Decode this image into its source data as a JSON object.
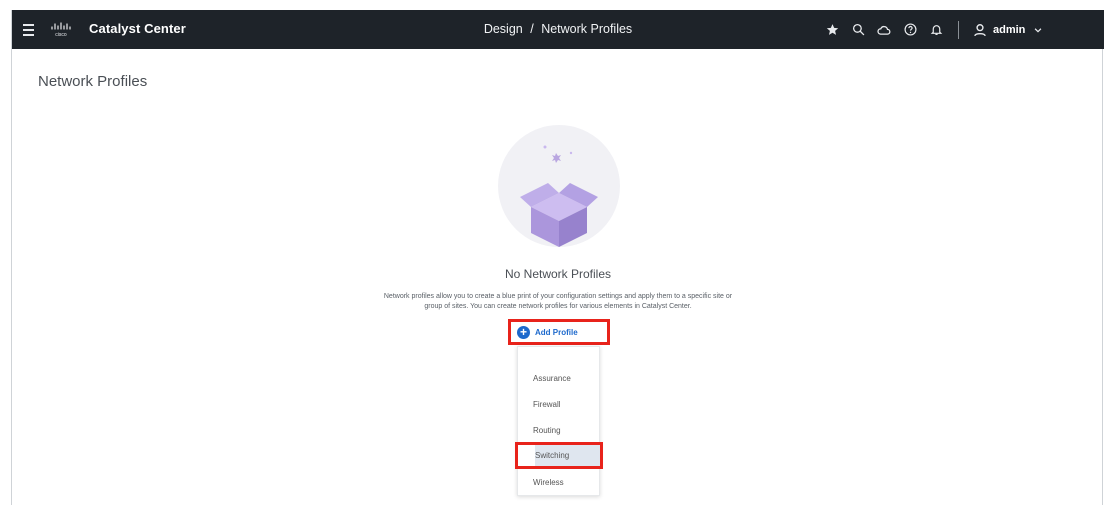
{
  "header": {
    "app_title": "Catalyst Center",
    "breadcrumb": [
      "Design",
      "/",
      "Network Profiles"
    ],
    "user_name": "admin",
    "icons": [
      "star-icon",
      "search-icon",
      "cloud-icon",
      "help-icon",
      "bell-icon",
      "user-icon",
      "chevron-down-icon"
    ]
  },
  "page": {
    "title": "Network Profiles"
  },
  "empty_state": {
    "title": "No Network Profiles",
    "description_line1": "Network profiles allow you to create a blue print of your configuration settings and apply them to a specific site or",
    "description_line2": "group of sites. You can create network profiles for various elements in Catalyst Center."
  },
  "add_button": {
    "label": "Add Profile"
  },
  "menu": {
    "items": [
      "Assurance",
      "Firewall",
      "Routing",
      "Switching",
      "Wireless"
    ],
    "highlighted": "Switching"
  },
  "colors": {
    "header_bg": "#1e2329",
    "accent": "#1d69cc",
    "highlight_border": "#e8231b",
    "illustration_purple": "#b9a6e0"
  }
}
